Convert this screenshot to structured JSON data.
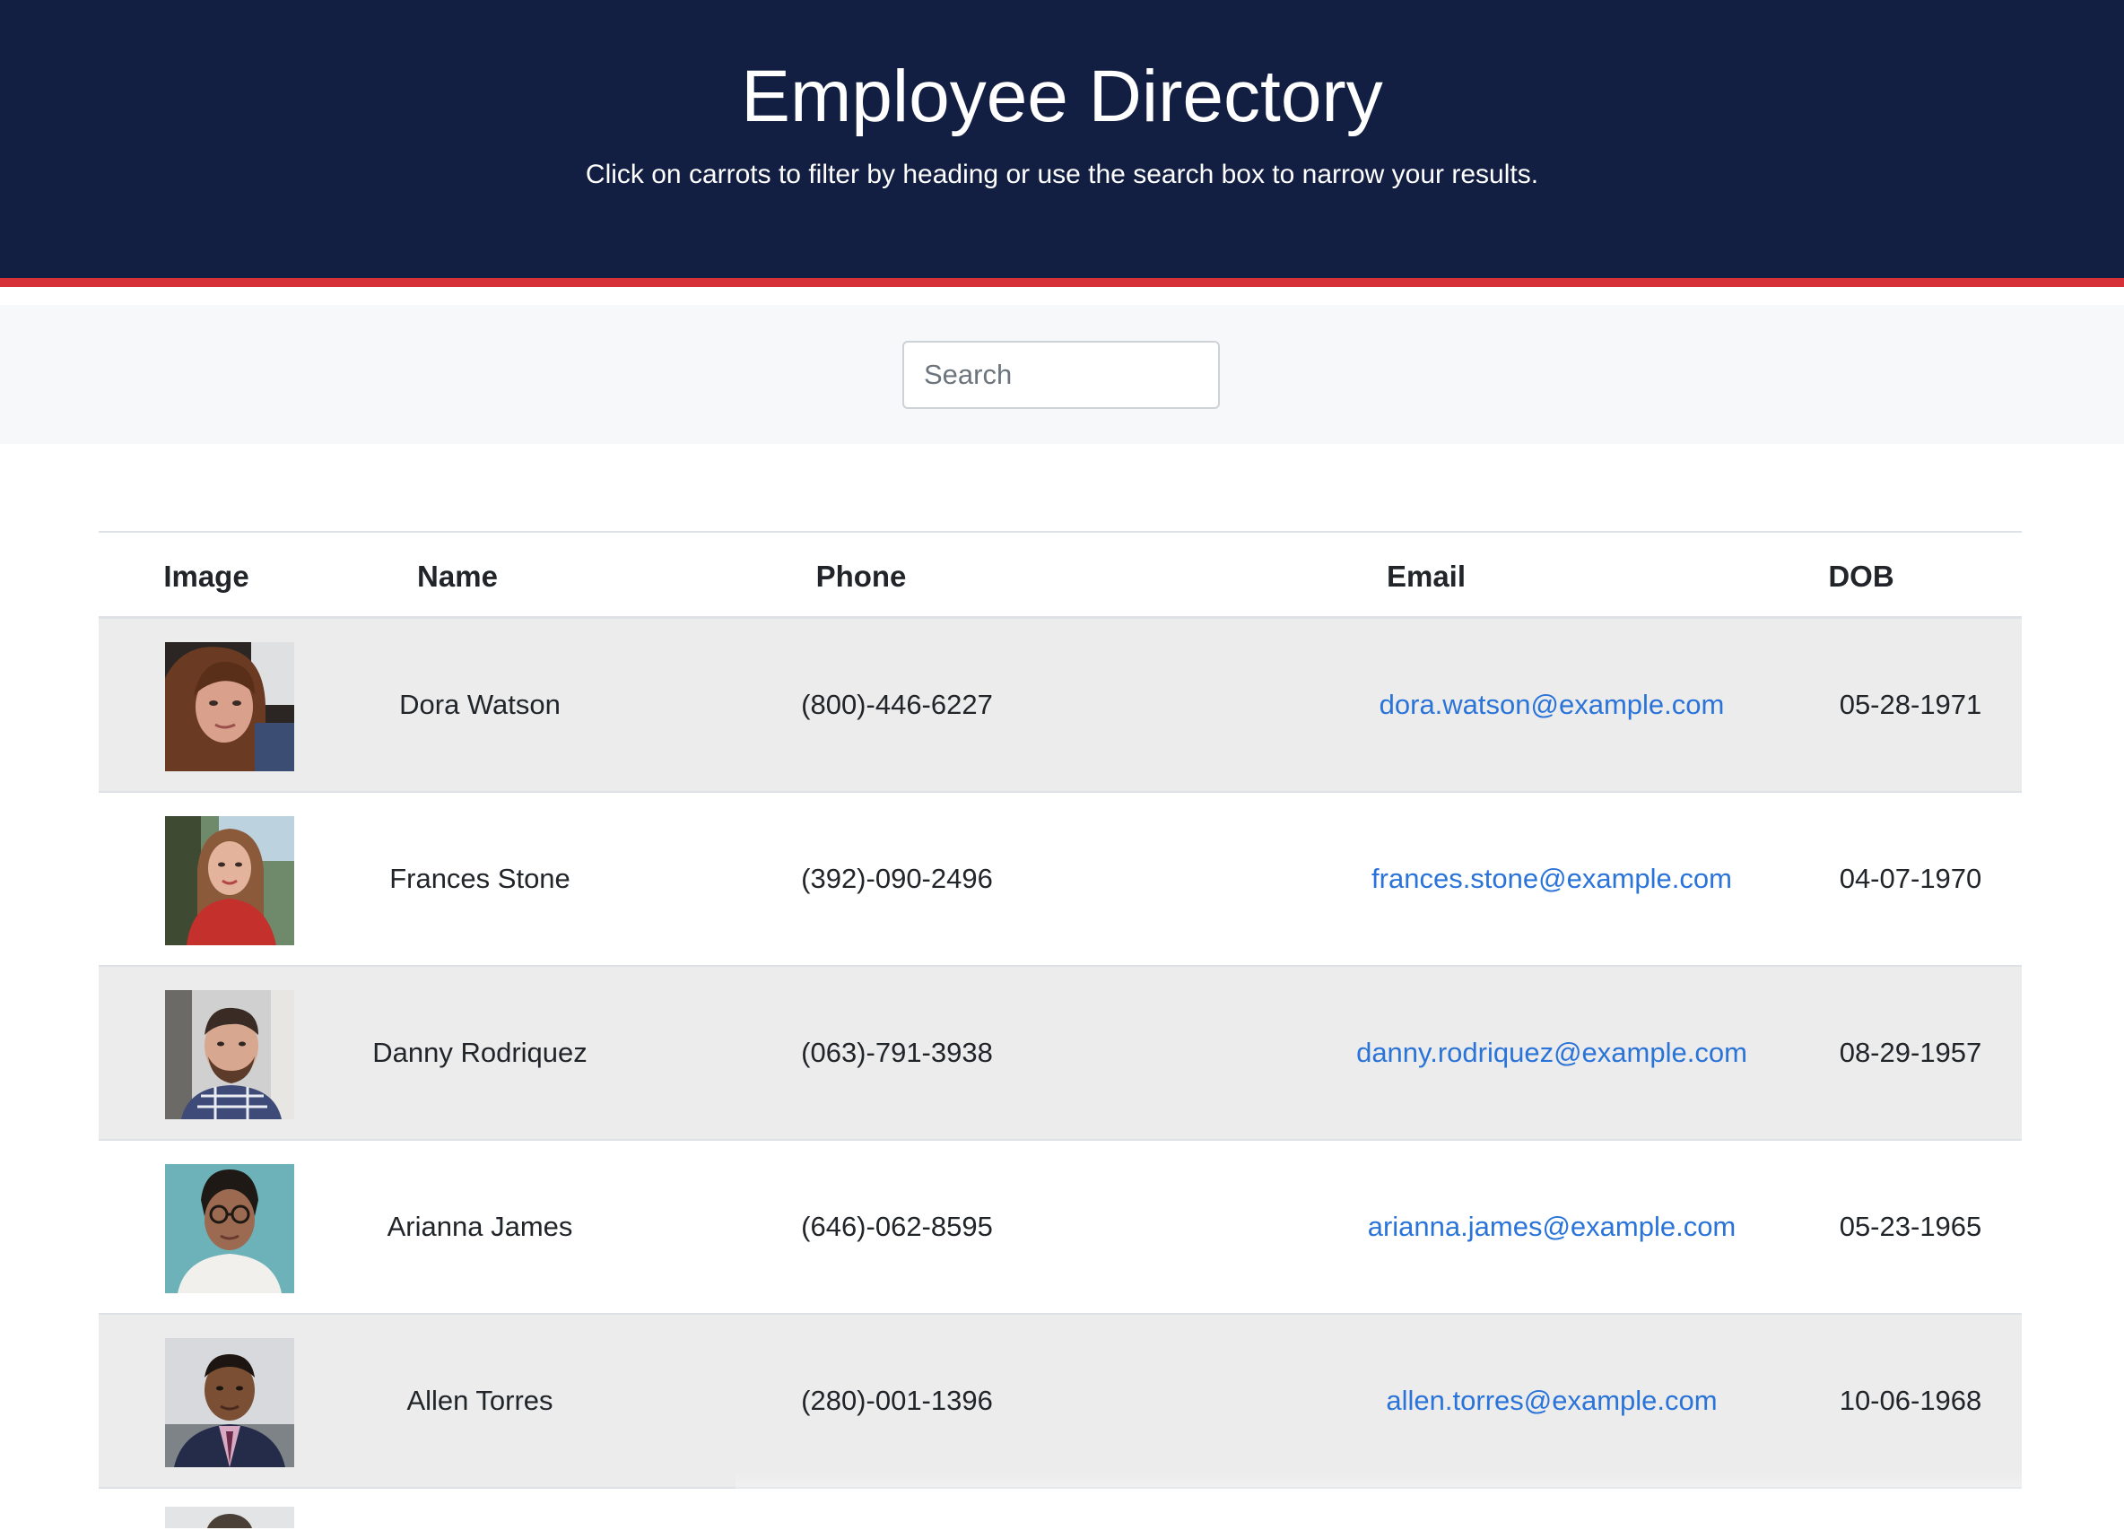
{
  "header": {
    "title": "Employee Directory",
    "subtitle": "Click on carrots to filter by heading or use the search box to narrow your results."
  },
  "search": {
    "placeholder": "Search",
    "value": ""
  },
  "table": {
    "columns": [
      "Image",
      "Name",
      "Phone",
      "Email",
      "DOB"
    ],
    "rows": [
      {
        "name": "Dora Watson",
        "phone": "(800)-446-6227",
        "email": "dora.watson@example.com",
        "dob": "05-28-1971",
        "avatar": "woman-portrait-icon"
      },
      {
        "name": "Frances Stone",
        "phone": "(392)-090-2496",
        "email": "frances.stone@example.com",
        "dob": "04-07-1970",
        "avatar": "woman-portrait-icon"
      },
      {
        "name": "Danny Rodriquez",
        "phone": "(063)-791-3938",
        "email": "danny.rodriquez@example.com",
        "dob": "08-29-1957",
        "avatar": "man-portrait-icon"
      },
      {
        "name": "Arianna James",
        "phone": "(646)-062-8595",
        "email": "arianna.james@example.com",
        "dob": "05-23-1965",
        "avatar": "woman-portrait-icon"
      },
      {
        "name": "Allen Torres",
        "phone": "(280)-001-1396",
        "email": "allen.torres@example.com",
        "dob": "10-06-1968",
        "avatar": "man-portrait-icon"
      }
    ]
  },
  "colors": {
    "header_bg": "#121e42",
    "accent_stripe": "#d63039",
    "link": "#2a74d9",
    "stripe_row": "#ececec"
  }
}
